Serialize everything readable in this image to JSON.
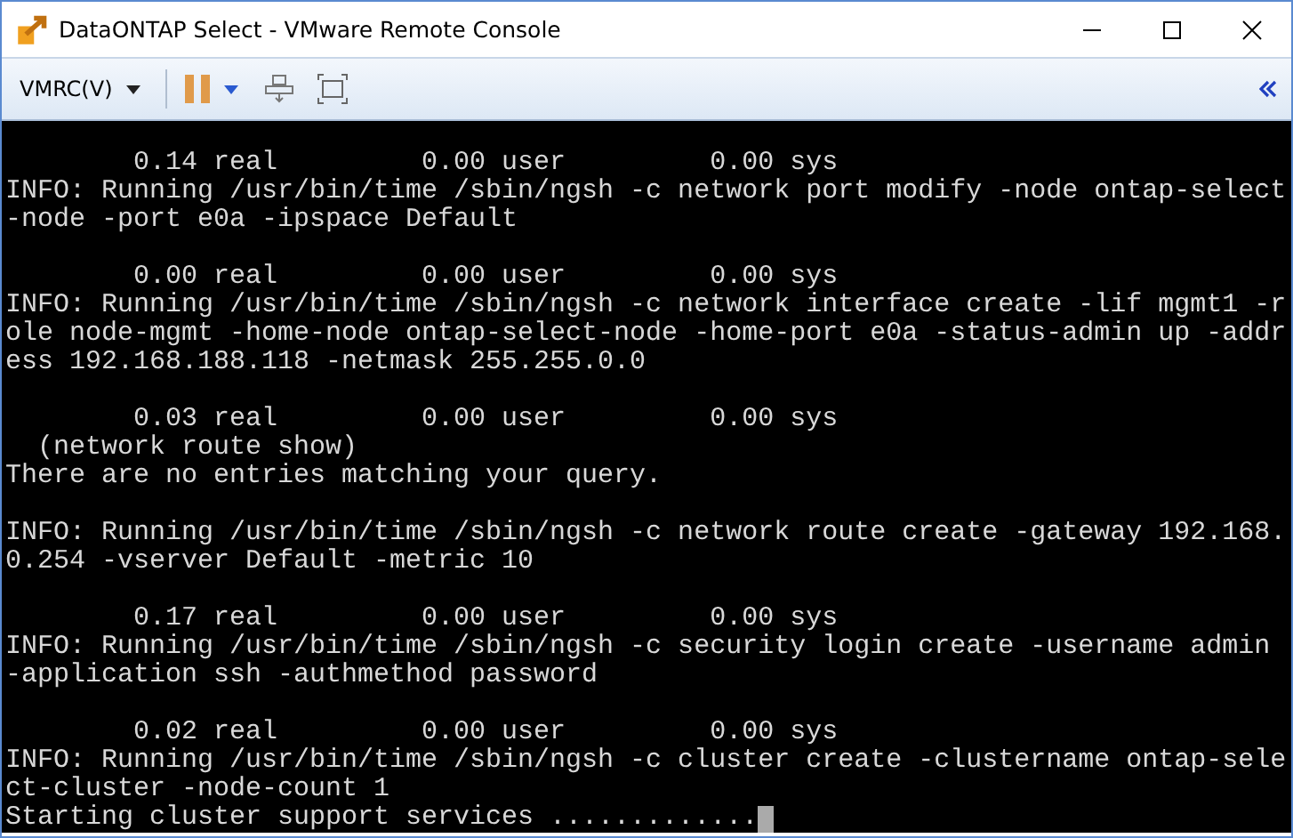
{
  "window": {
    "title": "DataONTAP Select - VMware Remote Console"
  },
  "toolbar": {
    "menu_label": "VMRC(V)",
    "paused": true
  },
  "console": {
    "cursor_visible": true,
    "blocks": [
      [
        "        0.14 real         0.00 user         0.00 sys",
        "INFO: Running /usr/bin/time /sbin/ngsh -c network port modify -node ontap-select",
        "-node -port e0a -ipspace Default"
      ],
      [
        "        0.00 real         0.00 user         0.00 sys",
        "INFO: Running /usr/bin/time /sbin/ngsh -c network interface create -lif mgmt1 -r",
        "ole node-mgmt -home-node ontap-select-node -home-port e0a -status-admin up -addr",
        "ess 192.168.188.118 -netmask 255.255.0.0"
      ],
      [
        "        0.03 real         0.00 user         0.00 sys",
        "  (network route show)",
        "There are no entries matching your query."
      ],
      [
        "INFO: Running /usr/bin/time /sbin/ngsh -c network route create -gateway 192.168.",
        "0.254 -vserver Default -metric 10"
      ],
      [
        "        0.17 real         0.00 user         0.00 sys",
        "INFO: Running /usr/bin/time /sbin/ngsh -c security login create -username admin",
        "-application ssh -authmethod password"
      ],
      [
        "        0.02 real         0.00 user         0.00 sys",
        "INFO: Running /usr/bin/time /sbin/ngsh -c cluster create -clustername ontap-sele",
        "ct-cluster -node-count 1",
        "Starting cluster support services ............."
      ]
    ]
  }
}
